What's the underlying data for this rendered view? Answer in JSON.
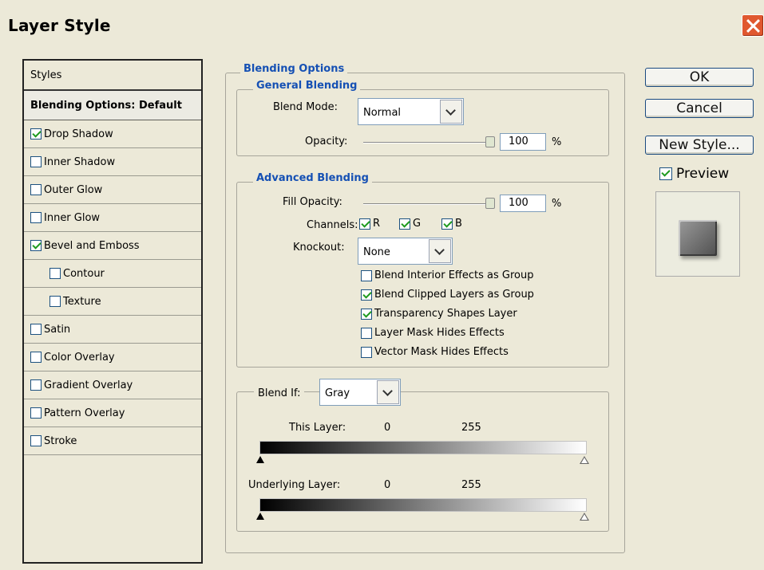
{
  "window": {
    "title": "Layer Style"
  },
  "styles": {
    "header": "Styles",
    "active": "Blending Options: Default",
    "items": [
      {
        "label": "Drop Shadow",
        "checked": true
      },
      {
        "label": "Inner Shadow",
        "checked": false
      },
      {
        "label": "Outer Glow",
        "checked": false
      },
      {
        "label": "Inner Glow",
        "checked": false
      },
      {
        "label": "Bevel and Emboss",
        "checked": true
      },
      {
        "label": "Contour",
        "checked": false
      },
      {
        "label": "Texture",
        "checked": false
      },
      {
        "label": "Satin",
        "checked": false
      },
      {
        "label": "Color Overlay",
        "checked": false
      },
      {
        "label": "Gradient Overlay",
        "checked": false
      },
      {
        "label": "Pattern Overlay",
        "checked": false
      },
      {
        "label": "Stroke",
        "checked": false
      }
    ]
  },
  "blending": {
    "section": "Blending Options",
    "general": "General Blending",
    "blend_mode_label": "Blend Mode:",
    "blend_mode_value": "Normal",
    "opacity_label": "Opacity:",
    "opacity_value": "100",
    "percent": "%"
  },
  "advanced": {
    "title": "Advanced Blending",
    "fill_opacity_label": "Fill Opacity:",
    "fill_opacity_value": "100",
    "percent": "%",
    "channels_label": "Channels:",
    "channels": {
      "r": "R",
      "g": "G",
      "b": "B"
    },
    "knockout_label": "Knockout:",
    "knockout_value": "None",
    "options": [
      {
        "label": "Blend Interior Effects as Group",
        "checked": false
      },
      {
        "label": "Blend Clipped Layers as Group",
        "checked": true
      },
      {
        "label": "Transparency Shapes Layer",
        "checked": true
      },
      {
        "label": "Layer Mask Hides Effects",
        "checked": false
      },
      {
        "label": "Vector Mask Hides Effects",
        "checked": false
      }
    ]
  },
  "blend_if": {
    "label": "Blend If:",
    "value": "Gray",
    "this_layer": "This Layer:",
    "this_low": "0",
    "this_high": "255",
    "underlying_layer": "Underlying Layer:",
    "underlying_low": "0",
    "underlying_high": "255"
  },
  "buttons": {
    "ok": "OK",
    "cancel": "Cancel",
    "new_style": "New Style...",
    "preview": "Preview"
  }
}
